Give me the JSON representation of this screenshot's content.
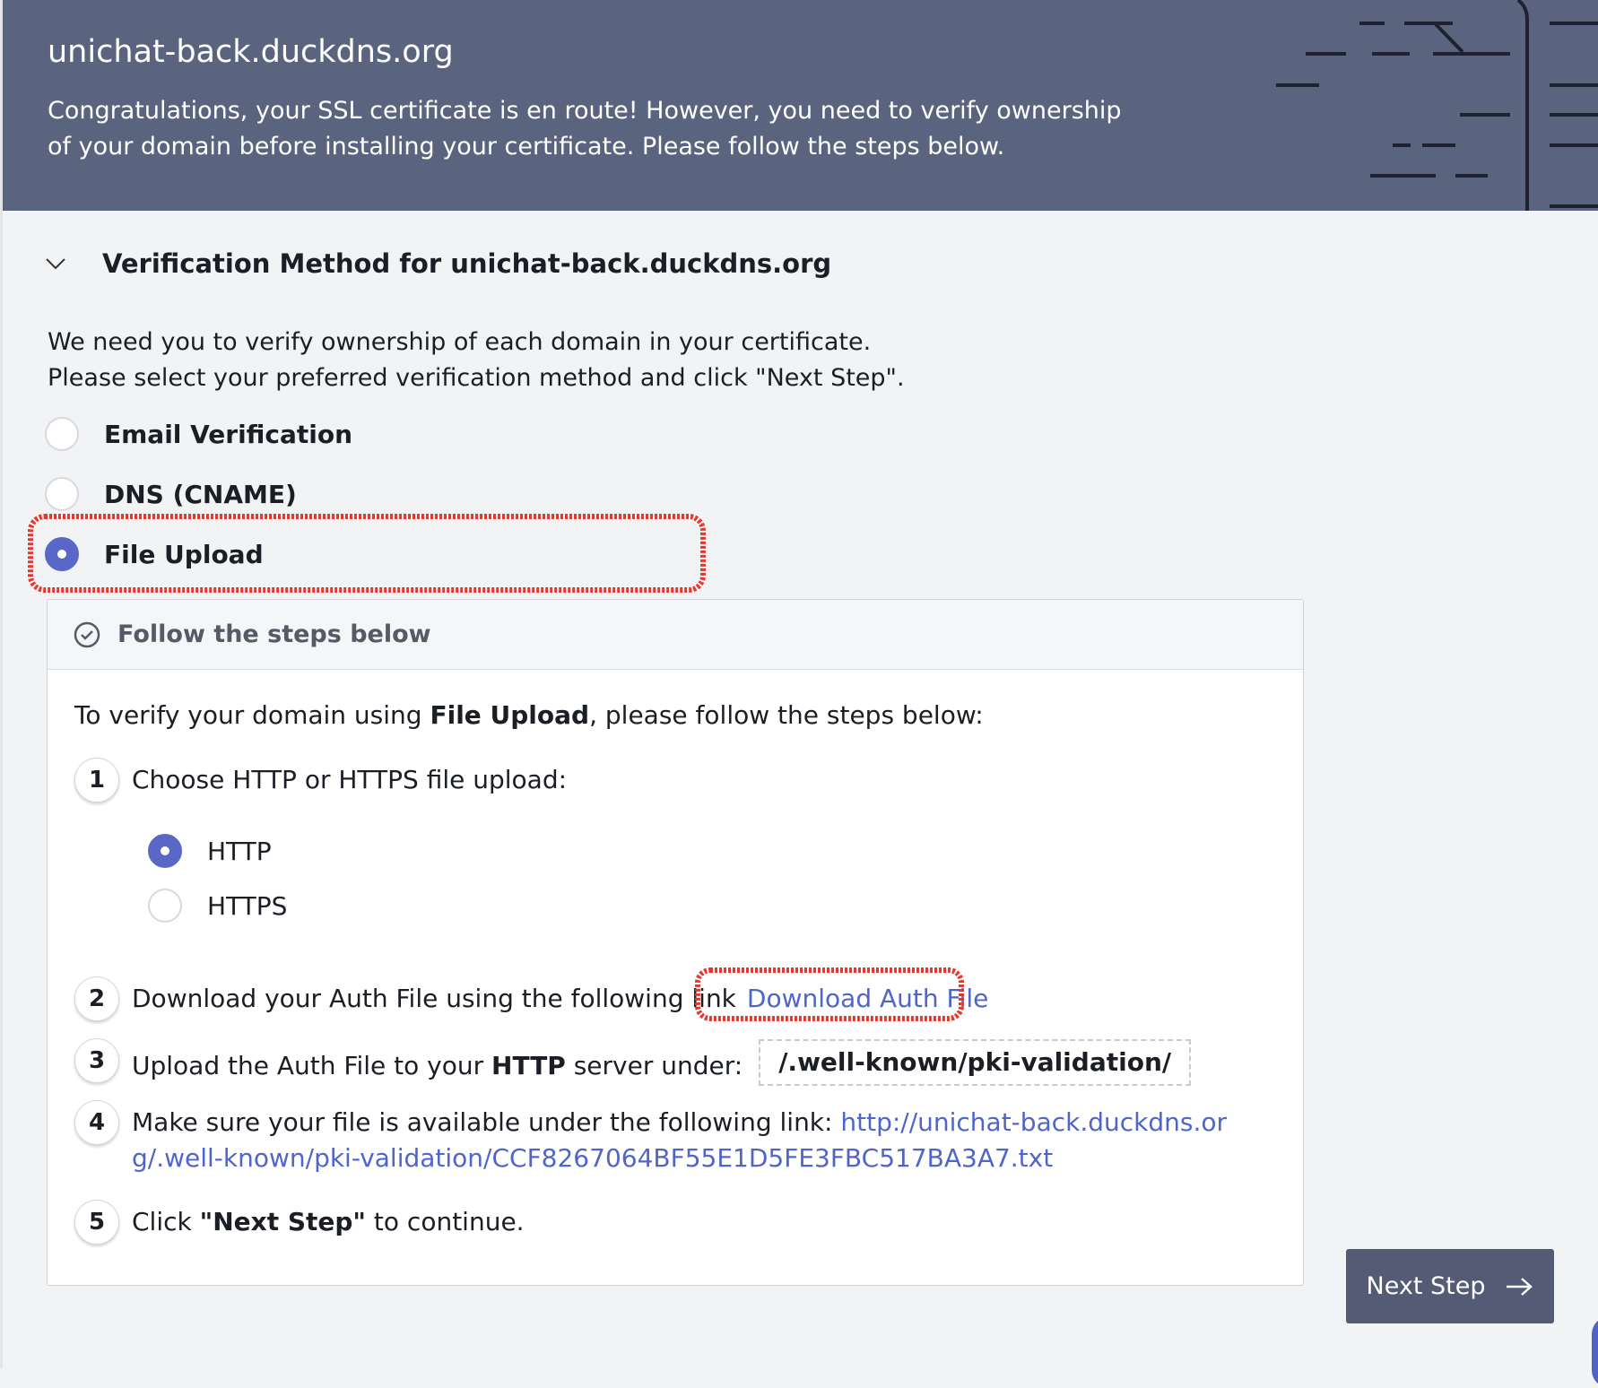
{
  "header": {
    "domain": "unichat-back.duckdns.org",
    "message": "Congratulations, your SSL certificate is en route! However, you need to verify ownership of your domain before installing your certificate. Please follow the steps below."
  },
  "section": {
    "title": "Verification Method for unichat-back.duckdns.org",
    "intro_line1": "We need you to verify ownership of each domain in your certificate.",
    "intro_line2": "Please select your preferred verification method and click \"Next Step\"."
  },
  "methods": [
    {
      "label": "Email Verification",
      "selected": false
    },
    {
      "label": "DNS (CNAME)",
      "selected": false
    },
    {
      "label": "File Upload",
      "selected": true
    }
  ],
  "panel": {
    "header": "Follow the steps below",
    "intro_prefix": "To verify your domain using ",
    "intro_bold": "File Upload",
    "intro_suffix": ", please follow the steps below:",
    "steps": [
      {
        "number": "1",
        "text": "Choose HTTP or HTTPS file upload:"
      },
      {
        "number": "2",
        "text": "Download your Auth File using the following link",
        "link": "Download Auth File"
      },
      {
        "number": "3",
        "text_prefix": "Upload the Auth File to your ",
        "text_bold": "HTTP",
        "text_suffix": " server under:",
        "path": "/.well-known/pki-validation/"
      },
      {
        "number": "4",
        "text": "Make sure your file is available under the following link: ",
        "link": "http://unichat-back.duckdns.org/.well-known/pki-validation/CCF8267064BF55E1D5FE3FBC517BA3A7.txt"
      },
      {
        "number": "5",
        "text_prefix": "Click ",
        "text_bold": "\"Next Step\"",
        "text_suffix": " to continue."
      }
    ],
    "protocols": [
      {
        "label": "HTTP",
        "selected": true
      },
      {
        "label": "HTTPS",
        "selected": false
      }
    ]
  },
  "next_button": {
    "label": "Next Step"
  },
  "colors": {
    "header_bg": "#5a647e",
    "accent": "#5968c6",
    "link": "#5065c9",
    "annotation": "#e8372a",
    "button_bg": "#535c74"
  },
  "icons": {
    "section_toggle": "chevron-down-icon",
    "panel_header": "check-circle-icon",
    "next_button": "arrow-right-icon"
  }
}
